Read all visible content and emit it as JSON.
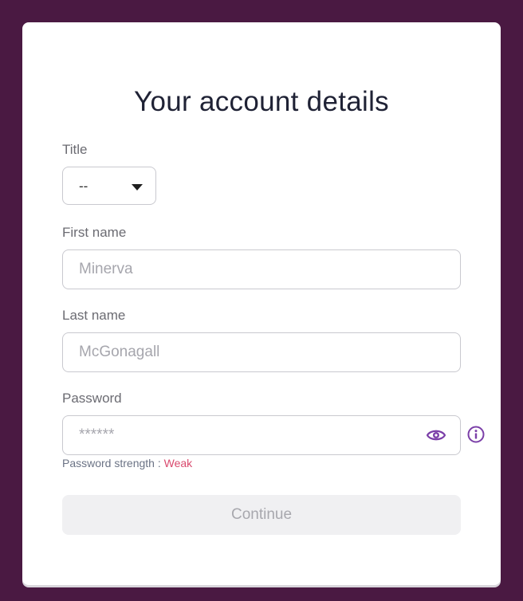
{
  "form": {
    "heading": "Your account details",
    "title_label": "Title",
    "title_value": "--",
    "first_name_label": "First name",
    "first_name_placeholder": "Minerva",
    "last_name_label": "Last name",
    "last_name_placeholder": "McGonagall",
    "password_label": "Password",
    "password_placeholder": "******",
    "strength_prefix": "Password strength : ",
    "strength_value": "Weak",
    "continue_label": "Continue"
  },
  "icons": {
    "title_dropdown": "caret-down-icon",
    "show_password": "eye-icon",
    "password_info": "info-icon"
  },
  "colors": {
    "page_background": "#4a1942",
    "accent": "#7b3fa8",
    "strength_weak": "#d94a6e",
    "button_disabled_bg": "#f0f0f2"
  }
}
